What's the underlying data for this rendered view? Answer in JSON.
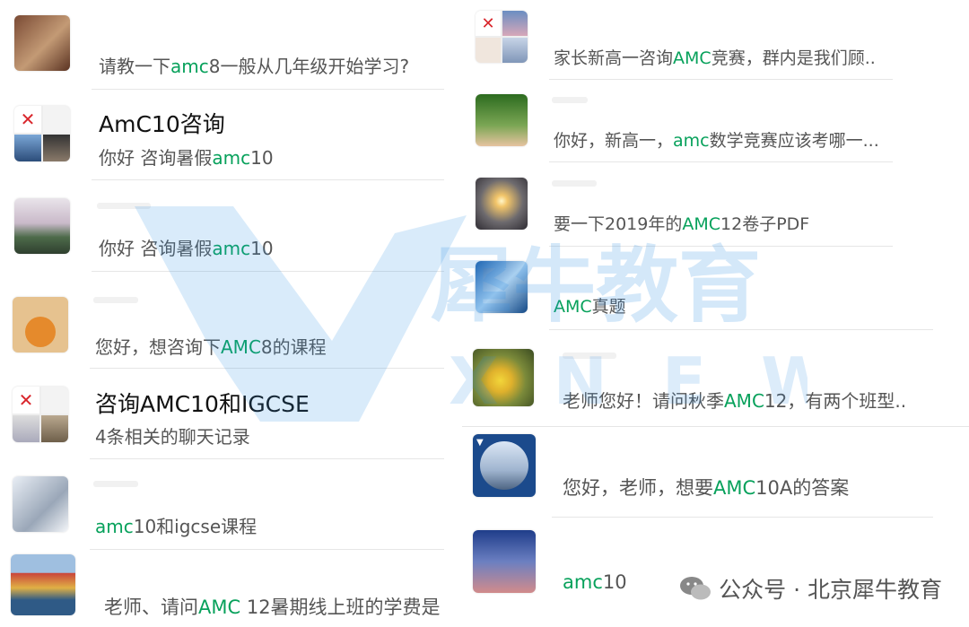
{
  "colors": {
    "highlight": "#07a15b",
    "watermark": "#2f8ee5"
  },
  "left_chats": [
    {
      "title": "",
      "message": [
        [
          "请教一下",
          false
        ],
        [
          "amc",
          true
        ],
        [
          "8一般从几年级开始学习?",
          false
        ]
      ]
    },
    {
      "title": [
        [
          "AmC10咨询",
          false
        ]
      ],
      "message": [
        [
          "你好 咨询暑假",
          false
        ],
        [
          "amc",
          true
        ],
        [
          "10",
          false
        ]
      ]
    },
    {
      "title": "",
      "message": [
        [
          "你好 咨询暑假",
          false
        ],
        [
          "amc",
          true
        ],
        [
          "10",
          false
        ]
      ]
    },
    {
      "title": "",
      "message": [
        [
          "您好，想咨询下",
          false
        ],
        [
          "AMC",
          true
        ],
        [
          "8的课程",
          false
        ]
      ]
    },
    {
      "title": [
        [
          "咨询AMC10和IGCSE",
          false
        ]
      ],
      "message": [
        [
          "4条相关的聊天记录",
          false
        ]
      ]
    },
    {
      "title": "",
      "message": [
        [
          "amc",
          true
        ],
        [
          "10和igcse课程",
          false
        ]
      ]
    },
    {
      "title": "",
      "message": [
        [
          "老师、请问",
          false
        ],
        [
          "AMC",
          true
        ],
        [
          " 12暑期线上班的学费是",
          false
        ]
      ]
    }
  ],
  "right_chats": [
    {
      "message": [
        [
          "家长新高一咨询",
          false
        ],
        [
          "AMC",
          true
        ],
        [
          "竞赛，群内是我们顾..",
          false
        ]
      ]
    },
    {
      "message": [
        [
          "你好，新高一，",
          false
        ],
        [
          "amc",
          true
        ],
        [
          "数学竞赛应该考哪一...",
          false
        ]
      ]
    },
    {
      "message": [
        [
          "要一下2019年的",
          false
        ],
        [
          "AMC",
          true
        ],
        [
          "12卷子PDF",
          false
        ]
      ]
    },
    {
      "message": [
        [
          "AMC",
          true
        ],
        [
          "真题",
          false
        ]
      ]
    },
    {
      "message": [
        [
          "老师您好！请问秋季",
          false
        ],
        [
          "AMC",
          true
        ],
        [
          "12，有两个班型..",
          false
        ]
      ]
    },
    {
      "message": [
        [
          "您好，老师，想要",
          false
        ],
        [
          "AMC",
          true
        ],
        [
          "10A的答案",
          false
        ]
      ]
    },
    {
      "message": [
        [
          "amc",
          true
        ],
        [
          "10",
          false
        ]
      ]
    }
  ],
  "watermark": {
    "brand_cn": "犀牛教育",
    "brand_en": "X  N E W"
  },
  "footer": {
    "wechat_label": "公众号 · 北京犀牛教育",
    "icon": "wechat-icon"
  }
}
